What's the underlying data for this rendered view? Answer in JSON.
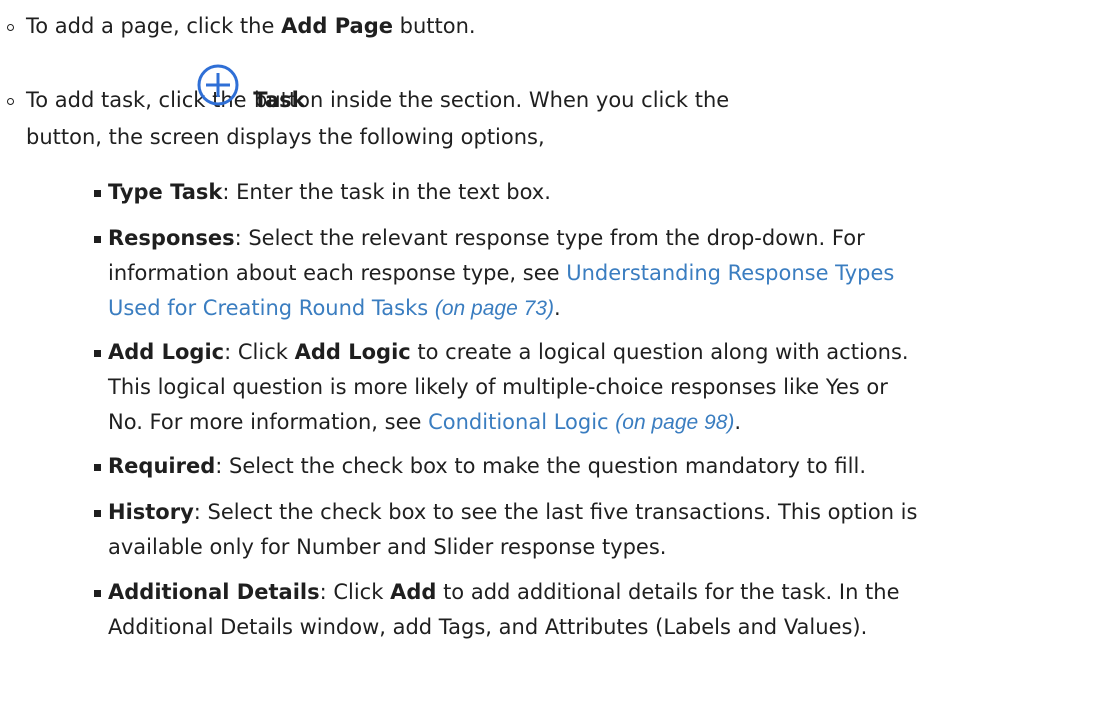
{
  "item1": {
    "pre": "To add a page, click the ",
    "bold": "Add Page",
    "post": " button."
  },
  "item2": {
    "pre": "To add task, click the ",
    "bold": "Task",
    "icon": "plus-circle-icon",
    "post": " button inside the section. When you click the",
    "line2": "button, the screen displays the following options,"
  },
  "options": {
    "type_task": {
      "term": "Type Task",
      "text": ": Enter the task in the text box."
    },
    "responses": {
      "term": "Responses",
      "text1": ": Select the relevant response type from the drop-down. For",
      "text2": "information about each response type, see ",
      "link1": "Understanding Response Types",
      "link2": "Used for Creating Round Tasks",
      "page_ref": "(on page 73)",
      "end": "."
    },
    "add_logic": {
      "term": "Add Logic",
      "text1a": ": Click ",
      "text1b": "Add Logic",
      "text1c": " to create a logical question along with actions.",
      "text2": "This logical question is more likely of multiple-choice responses like Yes or",
      "text3": "No. For more information, see ",
      "link": "Conditional Logic",
      "page_ref": "(on page 98)",
      "end": "."
    },
    "required": {
      "term": "Required",
      "text": ": Select the check box to make the question mandatory to fill."
    },
    "history": {
      "term": "History",
      "text1": ": Select the check box to see the last five transactions. This option is",
      "text2": "available only for Number and Slider response types."
    },
    "additional_details": {
      "term": "Additional Details",
      "text1a": ": Click ",
      "text1b": "Add",
      "text1c": " to add additional details for the task. In the",
      "text2": "Additional Details window, add Tags, and Attributes (Labels and Values)."
    }
  },
  "colors": {
    "text": "#1f1f1f",
    "link": "#3a7dc0",
    "icon": "#2f6fd6"
  }
}
